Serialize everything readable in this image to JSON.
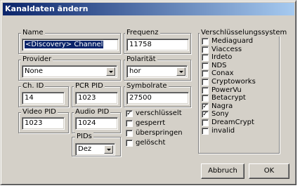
{
  "window": {
    "title": "Kanaldaten ändern"
  },
  "name": {
    "label": "Name",
    "value": "<Discovery> Channel"
  },
  "frequenz": {
    "label": "Frequenz",
    "value": "11758"
  },
  "provider": {
    "label": "Provider",
    "value": "None"
  },
  "polaritaet": {
    "label": "Polarität",
    "value": "hor"
  },
  "ch_id": {
    "label": "Ch. ID",
    "value": "14"
  },
  "pcr_pid": {
    "label": "PCR PID",
    "value": "1023"
  },
  "symbolrate": {
    "label": "Symbolrate",
    "value": "27500"
  },
  "video_pid": {
    "label": "Video PID",
    "value": "1023"
  },
  "audio_pid": {
    "label": "Audio PID",
    "value": "1024"
  },
  "pids": {
    "label": "PIDs",
    "value": "Dez"
  },
  "flags": [
    {
      "label": "verschlüsselt",
      "checked": true
    },
    {
      "label": "gesperrt",
      "checked": false
    },
    {
      "label": "überspringen",
      "checked": false
    },
    {
      "label": "gelöscht",
      "checked": false
    }
  ],
  "encryption": {
    "label": "Verschlüsselungssystem",
    "items": [
      {
        "label": "Mediaguard",
        "checked": false
      },
      {
        "label": "Viaccess",
        "checked": false
      },
      {
        "label": "Irdeto",
        "checked": false
      },
      {
        "label": "NDS",
        "checked": false
      },
      {
        "label": "Conax",
        "checked": false
      },
      {
        "label": "Cryptoworks",
        "checked": false
      },
      {
        "label": "PowerVu",
        "checked": false
      },
      {
        "label": "Betacrypt",
        "checked": false
      },
      {
        "label": "Nagra",
        "checked": true
      },
      {
        "label": "Sony",
        "checked": true
      },
      {
        "label": "DreamCrypt",
        "checked": false
      },
      {
        "label": "invalid",
        "checked": false
      }
    ]
  },
  "buttons": {
    "cancel": "Abbruch",
    "ok": "OK"
  }
}
